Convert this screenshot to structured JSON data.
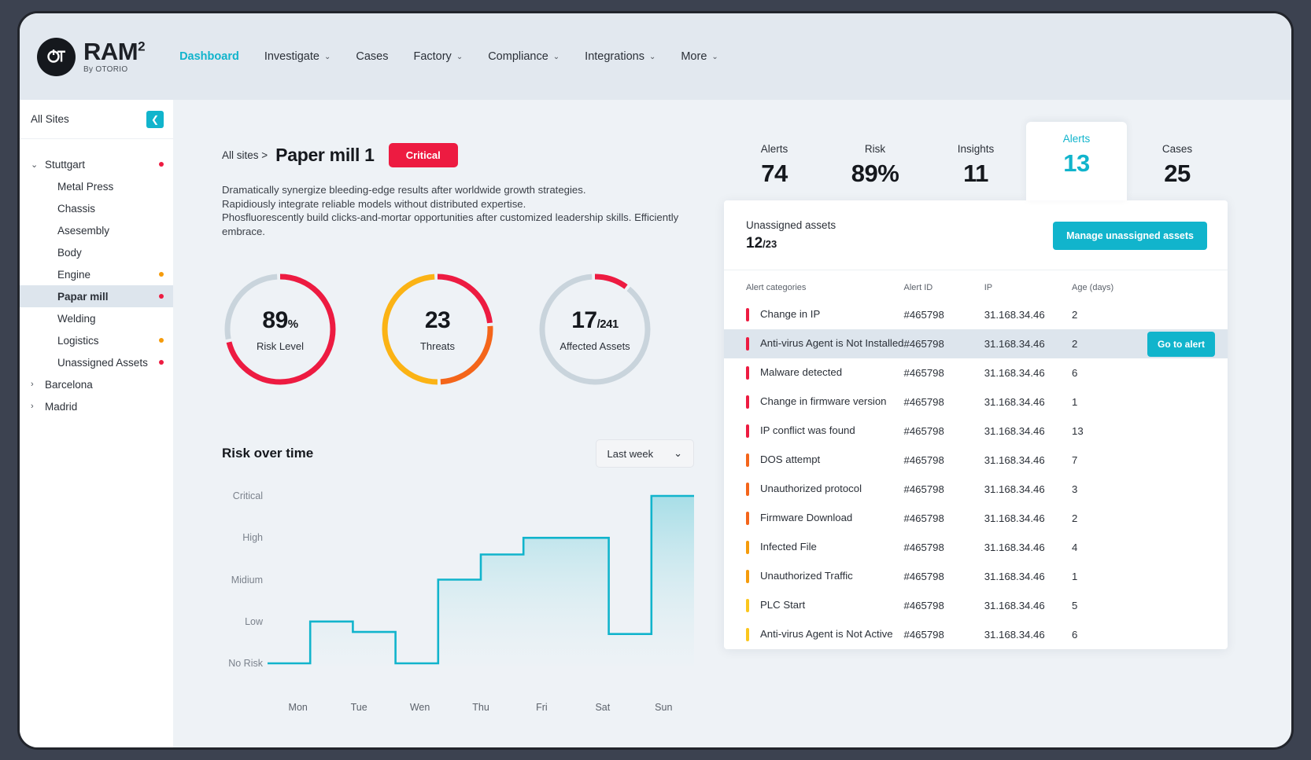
{
  "brand": {
    "logo_mark": "otorio-logo-icon",
    "title": "RAM",
    "superscript": "2",
    "subtitle": "By OTORIO"
  },
  "nav": [
    {
      "label": "Dashboard",
      "caret": false,
      "active": true
    },
    {
      "label": "Investigate",
      "caret": true,
      "active": false
    },
    {
      "label": "Cases",
      "caret": false,
      "active": false
    },
    {
      "label": "Factory",
      "caret": true,
      "active": false
    },
    {
      "label": "Compliance",
      "caret": true,
      "active": false
    },
    {
      "label": "Integrations",
      "caret": true,
      "active": false
    },
    {
      "label": "More",
      "caret": true,
      "active": false
    }
  ],
  "sidebar": {
    "header": "All Sites",
    "collapse_icon": "chevron-left-icon",
    "tree": [
      {
        "label": "Stuttgart",
        "type": "group",
        "expanded": true,
        "twisty": "chevron-down-icon",
        "dot": "#ed1b41"
      },
      {
        "label": "Metal Press",
        "type": "child",
        "dot": null
      },
      {
        "label": "Chassis",
        "type": "child",
        "dot": null
      },
      {
        "label": "Asesembly",
        "type": "child",
        "dot": null
      },
      {
        "label": "Body",
        "type": "child",
        "dot": null
      },
      {
        "label": "Engine",
        "type": "child",
        "dot": "#f59b0b"
      },
      {
        "label": "Papar mill",
        "type": "child",
        "dot": "#ed1b41",
        "selected": true
      },
      {
        "label": "Welding",
        "type": "child",
        "dot": null
      },
      {
        "label": "Logistics",
        "type": "child",
        "dot": "#f59b0b"
      },
      {
        "label": "Unassigned Assets",
        "type": "child",
        "dot": "#ed1b41"
      },
      {
        "label": "Barcelona",
        "type": "group",
        "expanded": false,
        "twisty": "chevron-right-icon",
        "dot": null
      },
      {
        "label": "Madrid",
        "type": "group",
        "expanded": false,
        "twisty": "chevron-right-icon",
        "dot": null
      }
    ]
  },
  "page": {
    "breadcrumb": "All sites >",
    "title": "Paper mill 1",
    "severity_badge": "Critical",
    "severity_color": "#ed1b41",
    "description": "Dramatically synergize bleeding-edge results after worldwide growth strategies.\nRapidiously integrate reliable models without distributed expertise.\nPhosfluorescently build clicks-and-mortar opportunities after customized leadership skills. Efficiently embrace."
  },
  "donuts": [
    {
      "value": "89",
      "suffix": "%",
      "label": "Risk Level",
      "percent": 89,
      "segments": [
        {
          "color": "#ed1b41",
          "pct": 72
        },
        {
          "color": "#c9d4dc",
          "pct": 28
        }
      ]
    },
    {
      "value": "23",
      "suffix": "",
      "label": "Threats",
      "percent": 100,
      "segments": [
        {
          "color": "#ed1b41",
          "pct": 24
        },
        {
          "color": "#f4651a",
          "pct": 26
        },
        {
          "color": "#fbb315",
          "pct": 50
        }
      ]
    },
    {
      "value": "17",
      "suffix": "/241",
      "label": "Affected Assets",
      "percent": 7,
      "segments": [
        {
          "color": "#ed1b41",
          "pct": 11
        },
        {
          "color": "#c9d4dc",
          "pct": 89
        }
      ]
    }
  ],
  "risk_chart": {
    "title": "Risk over time",
    "range_label": "Last week",
    "range_caret": "chevron-down-icon"
  },
  "chart_data": {
    "type": "area",
    "title": "Risk over time",
    "xlabel": "",
    "ylabel": "",
    "categories": [
      "Mon",
      "Tue",
      "Wen",
      "Thu",
      "Fri",
      "Sat",
      "Sun"
    ],
    "ytick_labels": [
      "No Risk",
      "Low",
      "Midium",
      "High",
      "Critical"
    ],
    "ytick_values": [
      0,
      1,
      2,
      3,
      4
    ],
    "values": [
      0,
      1,
      0,
      2,
      3,
      0.7,
      4
    ],
    "step_values": [
      0,
      1,
      0.75,
      0,
      2,
      2.6,
      3,
      3,
      0.7,
      4
    ],
    "ylim": [
      0,
      4
    ],
    "grid": false,
    "line_color": "#11b4cc",
    "fill": "gradient cyan to transparent",
    "legend": "none",
    "series": [
      {
        "name": "Risk",
        "values": [
          0,
          1,
          0,
          2,
          3,
          0.7,
          4
        ]
      }
    ]
  },
  "kpis": [
    {
      "label": "Alerts",
      "value": "74",
      "active": false
    },
    {
      "label": "Risk",
      "value": "89%",
      "active": false
    },
    {
      "label": "Insights",
      "value": "11",
      "active": false
    },
    {
      "label": "Alerts",
      "value": "13",
      "active": true
    },
    {
      "label": "Cases",
      "value": "25",
      "active": false
    }
  ],
  "alerts_card": {
    "unassigned_label": "Unassigned assets",
    "unassigned_count": "12",
    "unassigned_total": "/23",
    "manage_button": "Manage unassigned assets",
    "columns": [
      "Alert categories",
      "Alert ID",
      "IP",
      "Age (days)"
    ],
    "goto_button": "Go to alert",
    "rows": [
      {
        "severity": "#ed1b41",
        "category": "Change in IP",
        "id": "#465798",
        "ip": "31.168.34.46",
        "age": "2"
      },
      {
        "severity": "#ed1b41",
        "category": "Anti-virus Agent is Not Installed",
        "id": "#465798",
        "ip": "31.168.34.46",
        "age": "2",
        "highlighted": true
      },
      {
        "severity": "#ed1b41",
        "category": "Malware detected",
        "id": "#465798",
        "ip": "31.168.34.46",
        "age": "6"
      },
      {
        "severity": "#ed1b41",
        "category": "Change in firmware version",
        "id": "#465798",
        "ip": "31.168.34.46",
        "age": "1"
      },
      {
        "severity": "#ed1b41",
        "category": "IP conflict was found",
        "id": "#465798",
        "ip": "31.168.34.46",
        "age": "13"
      },
      {
        "severity": "#f4651a",
        "category": "DOS attempt",
        "id": "#465798",
        "ip": "31.168.34.46",
        "age": "7"
      },
      {
        "severity": "#f4651a",
        "category": "Unauthorized protocol",
        "id": "#465798",
        "ip": "31.168.34.46",
        "age": "3"
      },
      {
        "severity": "#f4651a",
        "category": "Firmware Download",
        "id": "#465798",
        "ip": "31.168.34.46",
        "age": "2"
      },
      {
        "severity": "#f59b0b",
        "category": "Infected File",
        "id": "#465798",
        "ip": "31.168.34.46",
        "age": "4"
      },
      {
        "severity": "#f59b0b",
        "category": "Unauthorized Traffic",
        "id": "#465798",
        "ip": "31.168.34.46",
        "age": "1"
      },
      {
        "severity": "#fbc61d",
        "category": "PLC Start",
        "id": "#465798",
        "ip": "31.168.34.46",
        "age": "5"
      },
      {
        "severity": "#fbc61d",
        "category": "Anti-virus Agent is Not Active",
        "id": "#465798",
        "ip": "31.168.34.46",
        "age": "6"
      }
    ]
  },
  "colors": {
    "accent": "#11b4cc",
    "critical": "#ed1b41",
    "high": "#f4651a",
    "medium": "#f59b0b",
    "low": "#fbc61d",
    "neutral": "#c9d4dc"
  }
}
